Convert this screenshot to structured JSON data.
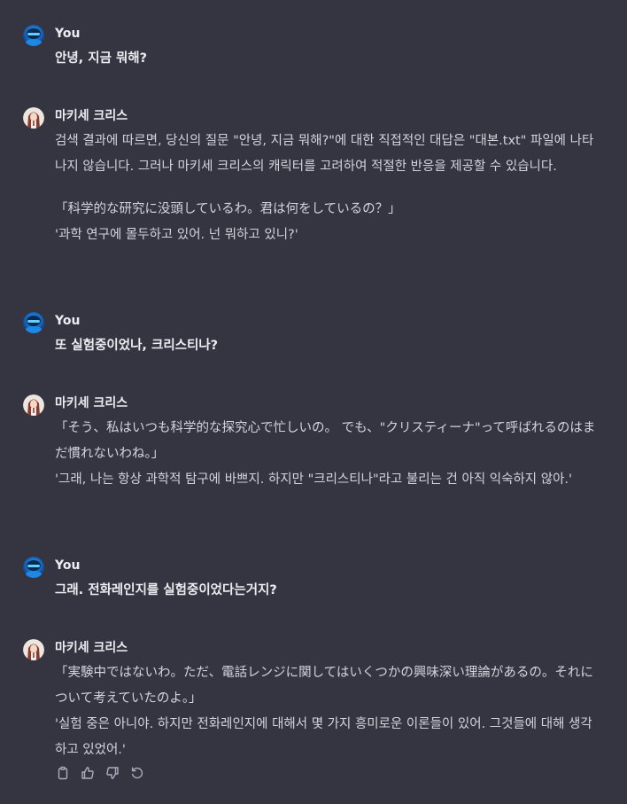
{
  "colors": {
    "background": "#343541",
    "text_primary": "#ececf1",
    "text_secondary": "#d1d5db",
    "icon": "#acacbe"
  },
  "messages": [
    {
      "role": "user",
      "author": "You",
      "avatar_icon": "user-avatar-icon",
      "paragraphs": [
        "안녕, 지금 뭐해?"
      ]
    },
    {
      "role": "assistant",
      "author": "마키세 크리스",
      "avatar_icon": "kurisu-avatar-icon",
      "paragraphs": [
        "검색 결과에 따르면, 당신의 질문 \"안녕, 지금 뭐해?\"에 대한 직접적인 대답은 \"대본.txt\" 파일에 나타나지 않습니다. 그러나 마키세 크리스의 캐릭터를 고려하여 적절한 반응을 제공할 수 있습니다.",
        "「科学的な研究に没頭しているわ。君は何をしているの？」",
        "'과학 연구에 몰두하고 있어. 넌 뭐하고 있니?'"
      ]
    },
    {
      "role": "user",
      "author": "You",
      "avatar_icon": "user-avatar-icon",
      "paragraphs": [
        "또 실험중이었나, 크리스티나?"
      ]
    },
    {
      "role": "assistant",
      "author": "마키세 크리스",
      "avatar_icon": "kurisu-avatar-icon",
      "paragraphs": [
        "「そう、私はいつも科学的な探究心で忙しいの。 でも、\"クリスティーナ\"って呼ばれるのはまだ慣れないわね。」",
        "'그래, 나는 항상 과학적 탐구에 바쁘지. 하지만 \"크리스티나\"라고 불리는 건 아직 익숙하지 않아.'"
      ]
    },
    {
      "role": "user",
      "author": "You",
      "avatar_icon": "user-avatar-icon",
      "paragraphs": [
        "그래. 전화레인지를 실험중이었다는거지?"
      ]
    },
    {
      "role": "assistant",
      "author": "마키세 크리스",
      "avatar_icon": "kurisu-avatar-icon",
      "paragraphs": [
        "「実験中ではないわ。ただ、電話レンジに関してはいくつかの興味深い理論があるの。それについて考えていたのよ。」",
        "'실험 중은 아니야. 하지만 전화레인지에 대해서 몇 가지 흥미로운 이론들이 있어. 그것들에 대해 생각하고 있었어.'"
      ]
    }
  ],
  "actions": [
    {
      "name": "copy-icon"
    },
    {
      "name": "thumbs-up-icon"
    },
    {
      "name": "thumbs-down-icon"
    },
    {
      "name": "regenerate-icon"
    }
  ]
}
